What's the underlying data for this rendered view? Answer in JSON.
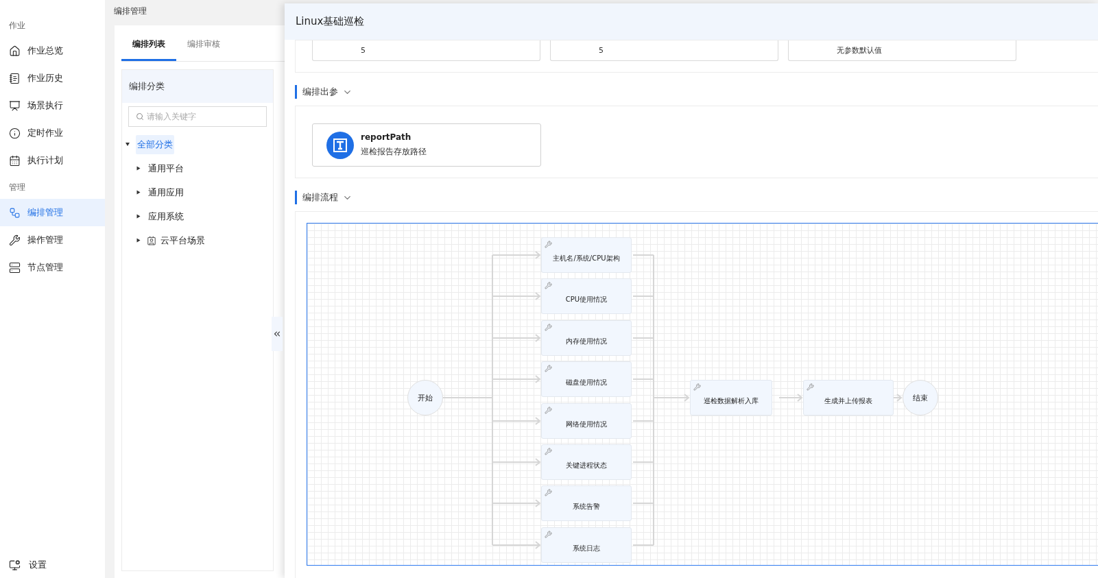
{
  "sidebar": {
    "sections": [
      {
        "title": "作业",
        "items": [
          {
            "label": "作业总览",
            "selected": false
          },
          {
            "label": "作业历史",
            "selected": false
          },
          {
            "label": "场景执行",
            "selected": false
          },
          {
            "label": "定时作业",
            "selected": false
          },
          {
            "label": "执行计划",
            "selected": false
          }
        ]
      },
      {
        "title": "管理",
        "items": [
          {
            "label": "编排管理",
            "selected": true
          },
          {
            "label": "操作管理",
            "selected": false
          },
          {
            "label": "节点管理",
            "selected": false
          }
        ]
      }
    ],
    "footer": {
      "label": "设置"
    }
  },
  "breadcrumb": "编排管理",
  "tabs": [
    {
      "label": "编排列表",
      "selected": true
    },
    {
      "label": "编排审核",
      "selected": false
    }
  ],
  "category_panel": {
    "title": "编排分类",
    "search": {
      "placeholder": "请输入关键字"
    },
    "tree": [
      {
        "label": "全部分类",
        "selected": true,
        "expanded": true,
        "children": [
          {
            "label": "通用平台",
            "kind": "plain",
            "selected": false,
            "expanded": false
          },
          {
            "label": "通用应用",
            "kind": "plain",
            "selected": false,
            "expanded": false
          },
          {
            "label": "应用系统",
            "kind": "plain",
            "selected": false,
            "expanded": false
          },
          {
            "label": "云平台场景",
            "kind": "scene",
            "selected": false,
            "expanded": false
          }
        ]
      }
    ]
  },
  "drawer": {
    "title": "Linux基础巡检",
    "input_params": [
      {
        "value": "5"
      },
      {
        "value": "5"
      },
      {
        "value": "无参数默认值"
      }
    ],
    "output_section": {
      "title": "编排出参",
      "params": [
        {
          "name": "reportPath",
          "description": "巡检报告存放路径"
        }
      ]
    },
    "flow_section": {
      "title": "编排流程",
      "flow": {
        "start": "开始",
        "parallel_tasks": [
          "主机名/系统/CPU架构",
          "CPU使用情况",
          "内存使用情况",
          "磁盘使用情况",
          "网络使用情况",
          "关键进程状态",
          "系统告警",
          "系统日志"
        ],
        "sequence_tasks": [
          "巡检数据解析入库",
          "生成并上传报表"
        ],
        "end": "结束"
      }
    }
  }
}
